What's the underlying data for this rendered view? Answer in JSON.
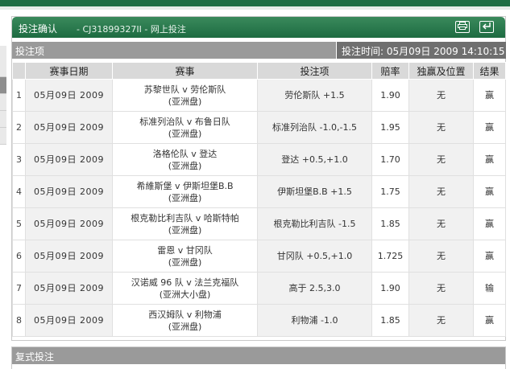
{
  "header": {
    "title": "投注确认",
    "code": "- CJ31899327II - 网上投注",
    "print_icon": "printer-icon",
    "back_icon": "back-arrow-icon"
  },
  "section": {
    "label": "投注项",
    "time": "投注时间: 05月09日 2009 14:10:15"
  },
  "columns": [
    "",
    "赛事日期",
    "赛事",
    "投注项",
    "赔率",
    "独赢及位置",
    "结果"
  ],
  "rows": [
    {
      "idx": "1",
      "date": "05月09日 2009",
      "match_line1": "苏黎世队 v 劳伦斯队",
      "match_line2": "(亚洲盘)",
      "bet": "劳伦斯队 +1.5",
      "odds": "1.90",
      "place": "无",
      "result": "赢"
    },
    {
      "idx": "2",
      "date": "05月09日 2009",
      "match_line1": "标准列治队 v 布鲁日队",
      "match_line2": "(亚洲盘)",
      "bet": "标准列治队 -1.0,-1.5",
      "odds": "1.95",
      "place": "无",
      "result": "赢"
    },
    {
      "idx": "3",
      "date": "05月09日 2009",
      "match_line1": "洛格伦队 v 登达",
      "match_line2": "(亚洲盘)",
      "bet": "登达 +0.5,+1.0",
      "odds": "1.70",
      "place": "无",
      "result": "赢"
    },
    {
      "idx": "4",
      "date": "05月09日 2009",
      "match_line1": "希維斯堡 v 伊斯坦堡B.B",
      "match_line2": "(亚洲盘)",
      "bet": "伊斯坦堡B.B +1.5",
      "odds": "1.75",
      "place": "无",
      "result": "赢"
    },
    {
      "idx": "5",
      "date": "05月09日 2009",
      "match_line1": "根克勒比利吉队 v 哈斯特帕",
      "match_line2": "(亚洲盘)",
      "bet": "根克勒比利吉队 -1.5",
      "odds": "1.85",
      "place": "无",
      "result": "赢"
    },
    {
      "idx": "6",
      "date": "05月09日 2009",
      "match_line1": "雷恩 v 甘冈队",
      "match_line2": "(亚洲盘)",
      "bet": "甘冈队 +0.5,+1.0",
      "odds": "1.725",
      "place": "无",
      "result": "赢"
    },
    {
      "idx": "7",
      "date": "05月09日 2009",
      "match_line1": "汉诺威 96 队 v 法兰克福队",
      "match_line2": "(亚洲大小盘)",
      "bet": "高于 2.5,3.0",
      "odds": "1.90",
      "place": "无",
      "result": "输"
    },
    {
      "idx": "8",
      "date": "05月09日 2009",
      "match_line1": "西汉姆队 v 利物浦",
      "match_line2": "(亚洲盘)",
      "bet": "利物浦 -1.0",
      "odds": "1.85",
      "place": "无",
      "result": "赢"
    }
  ],
  "section2": {
    "label": "复式投注"
  },
  "colors": {
    "header_green": "#1d6b41",
    "section_grey": "#9a9a9a",
    "time_grey": "#6f6f6f"
  }
}
